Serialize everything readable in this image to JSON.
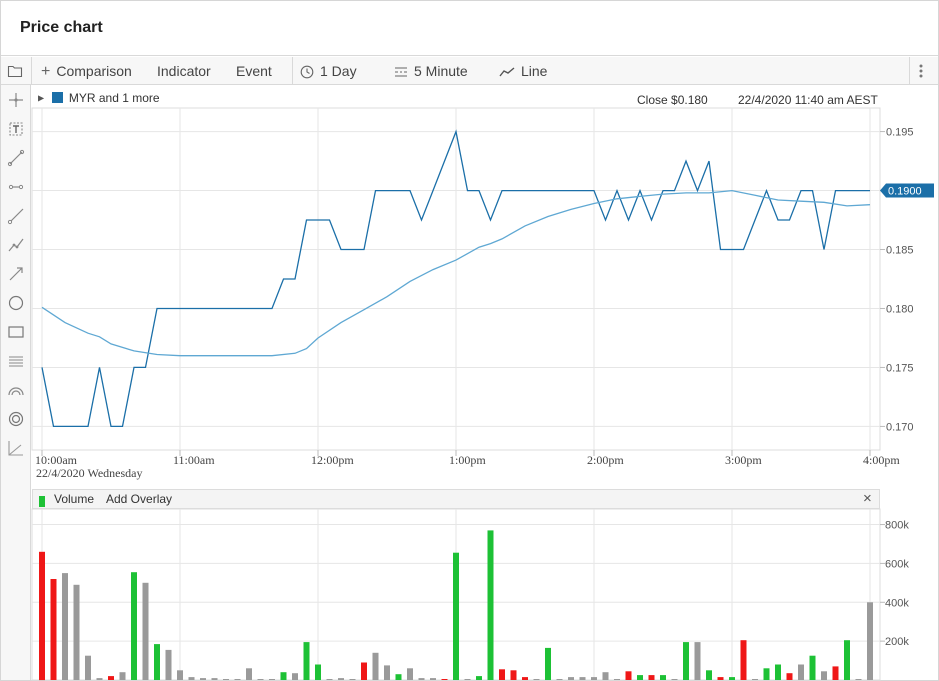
{
  "window": {
    "title": "Price chart"
  },
  "toolbar": {
    "comparison_label": "Comparison",
    "indicator_label": "Indicator",
    "event_label": "Event",
    "range_label": "1 Day",
    "interval_label": "5 Minute",
    "chart_type_label": "Line"
  },
  "legend": {
    "series_label": "MYR and 1 more",
    "close_label": "Close $0.180",
    "timestamp": "22/4/2020 11:40 am AEST",
    "series_color": "#1b6fa8"
  },
  "volume_panel": {
    "label": "Volume",
    "add_overlay_label": "Add Overlay",
    "close_symbol": "×"
  },
  "chart_data": [
    {
      "type": "line",
      "title": "",
      "x_tick_labels": [
        "10:00am",
        "11:00am",
        "12:00pm",
        "1:00pm",
        "2:00pm",
        "3:00pm",
        "4:00pm"
      ],
      "x_date_label": "22/4/2020 Wednesday",
      "x_range": [
        "10:00",
        "16:00"
      ],
      "ylim": [
        0.168,
        0.197
      ],
      "y_ticks": [
        "0.170",
        "0.175",
        "0.180",
        "0.185",
        "0.190",
        "0.195"
      ],
      "current_value_label": "0.1900",
      "grid": true,
      "series": [
        {
          "color": "#1b6fa8",
          "x": [
            "10:00",
            "10:05",
            "10:10",
            "10:15",
            "10:20",
            "10:25",
            "10:30",
            "10:35",
            "10:40",
            "10:45",
            "10:50",
            "10:55",
            "11:00",
            "11:05",
            "11:10",
            "11:15",
            "11:20",
            "11:25",
            "11:30",
            "11:35",
            "11:40",
            "11:45",
            "11:50",
            "11:55",
            "12:00",
            "12:05",
            "12:10",
            "12:15",
            "12:20",
            "12:25",
            "12:30",
            "12:35",
            "12:40",
            "12:45",
            "12:50",
            "12:55",
            "13:00",
            "13:05",
            "13:10",
            "13:15",
            "13:20",
            "13:25",
            "13:30",
            "13:35",
            "13:40",
            "13:45",
            "13:50",
            "13:55",
            "14:00",
            "14:05",
            "14:10",
            "14:15",
            "14:20",
            "14:25",
            "14:30",
            "14:35",
            "14:40",
            "14:45",
            "14:50",
            "14:55",
            "15:00",
            "15:05",
            "15:10",
            "15:15",
            "15:20",
            "15:25",
            "15:30",
            "15:35",
            "15:40",
            "15:45",
            "15:50",
            "15:55",
            "16:00"
          ],
          "values": [
            0.175,
            0.17,
            0.17,
            0.17,
            0.17,
            0.175,
            0.17,
            0.17,
            0.175,
            0.175,
            0.18,
            0.18,
            0.18,
            0.18,
            0.18,
            0.18,
            0.18,
            0.18,
            0.18,
            0.18,
            0.18,
            0.1825,
            0.1825,
            0.1875,
            0.1875,
            0.1875,
            0.185,
            0.185,
            0.185,
            0.19,
            0.19,
            0.19,
            0.19,
            0.1875,
            0.19,
            0.1925,
            0.195,
            0.19,
            0.19,
            0.1875,
            0.19,
            0.19,
            0.19,
            0.19,
            0.19,
            0.19,
            0.19,
            0.19,
            0.19,
            0.1875,
            0.19,
            0.1875,
            0.19,
            0.1875,
            0.19,
            0.19,
            0.1925,
            0.19,
            0.1925,
            0.185,
            0.185,
            0.185,
            0.1875,
            0.19,
            0.1875,
            0.1875,
            0.19,
            0.19,
            0.185,
            0.19,
            0.19,
            0.19,
            0.19
          ]
        },
        {
          "color": "#5fa8d3",
          "x": [
            "10:00",
            "10:10",
            "10:20",
            "10:25",
            "10:30",
            "10:40",
            "10:50",
            "11:00",
            "11:20",
            "11:40",
            "11:50",
            "11:55",
            "12:00",
            "12:10",
            "12:20",
            "12:30",
            "12:40",
            "12:50",
            "13:00",
            "13:10",
            "13:15",
            "13:20",
            "13:30",
            "13:40",
            "13:50",
            "14:00",
            "14:10",
            "14:20",
            "14:30",
            "14:40",
            "14:50",
            "15:00",
            "15:10",
            "15:20",
            "15:30",
            "15:40",
            "15:50",
            "16:00"
          ],
          "values": [
            0.1801,
            0.1788,
            0.1779,
            0.1776,
            0.177,
            0.1764,
            0.1761,
            0.176,
            0.176,
            0.176,
            0.1762,
            0.1766,
            0.1775,
            0.1788,
            0.1799,
            0.181,
            0.1823,
            0.1833,
            0.1841,
            0.1852,
            0.1855,
            0.1859,
            0.187,
            0.1878,
            0.1884,
            0.1889,
            0.1893,
            0.1895,
            0.1897,
            0.1898,
            0.1898,
            0.19,
            0.1896,
            0.1892,
            0.1891,
            0.189,
            0.1887,
            0.1888
          ]
        }
      ]
    },
    {
      "type": "bar",
      "title": "",
      "ylim": [
        0,
        880000
      ],
      "y_ticks": [
        "200k",
        "400k",
        "600k",
        "800k"
      ],
      "x_range": [
        "10:00",
        "16:00"
      ],
      "grid": true,
      "colors": {
        "up": "#1dc135",
        "down": "#ef1717",
        "flat": "#9a9a9a"
      },
      "bars": [
        {
          "t": "10:00",
          "v": 660000,
          "c": "down"
        },
        {
          "t": "10:05",
          "v": 520000,
          "c": "down"
        },
        {
          "t": "10:10",
          "v": 550000,
          "c": "flat"
        },
        {
          "t": "10:15",
          "v": 490000,
          "c": "flat"
        },
        {
          "t": "10:20",
          "v": 125000,
          "c": "flat"
        },
        {
          "t": "10:25",
          "v": 10000,
          "c": "flat"
        },
        {
          "t": "10:30",
          "v": 20000,
          "c": "down"
        },
        {
          "t": "10:35",
          "v": 40000,
          "c": "flat"
        },
        {
          "t": "10:40",
          "v": 555000,
          "c": "up"
        },
        {
          "t": "10:45",
          "v": 500000,
          "c": "flat"
        },
        {
          "t": "10:50",
          "v": 185000,
          "c": "up"
        },
        {
          "t": "10:55",
          "v": 155000,
          "c": "flat"
        },
        {
          "t": "11:00",
          "v": 50000,
          "c": "flat"
        },
        {
          "t": "11:05",
          "v": 15000,
          "c": "flat"
        },
        {
          "t": "11:10",
          "v": 10000,
          "c": "flat"
        },
        {
          "t": "11:15",
          "v": 10000,
          "c": "flat"
        },
        {
          "t": "11:20",
          "v": 5000,
          "c": "flat"
        },
        {
          "t": "11:25",
          "v": 5000,
          "c": "flat"
        },
        {
          "t": "11:30",
          "v": 60000,
          "c": "flat"
        },
        {
          "t": "11:35",
          "v": 5000,
          "c": "flat"
        },
        {
          "t": "11:40",
          "v": 5000,
          "c": "flat"
        },
        {
          "t": "11:45",
          "v": 40000,
          "c": "up"
        },
        {
          "t": "11:50",
          "v": 35000,
          "c": "flat"
        },
        {
          "t": "11:55",
          "v": 195000,
          "c": "up"
        },
        {
          "t": "12:00",
          "v": 80000,
          "c": "up"
        },
        {
          "t": "12:05",
          "v": 5000,
          "c": "flat"
        },
        {
          "t": "12:10",
          "v": 10000,
          "c": "flat"
        },
        {
          "t": "12:15",
          "v": 5000,
          "c": "flat"
        },
        {
          "t": "12:20",
          "v": 90000,
          "c": "down"
        },
        {
          "t": "12:25",
          "v": 140000,
          "c": "flat"
        },
        {
          "t": "12:30",
          "v": 75000,
          "c": "flat"
        },
        {
          "t": "12:35",
          "v": 30000,
          "c": "up"
        },
        {
          "t": "12:40",
          "v": 60000,
          "c": "flat"
        },
        {
          "t": "12:45",
          "v": 10000,
          "c": "flat"
        },
        {
          "t": "12:50",
          "v": 10000,
          "c": "flat"
        },
        {
          "t": "12:55",
          "v": 5000,
          "c": "down"
        },
        {
          "t": "13:00",
          "v": 655000,
          "c": "up"
        },
        {
          "t": "13:05",
          "v": 5000,
          "c": "flat"
        },
        {
          "t": "13:10",
          "v": 20000,
          "c": "up"
        },
        {
          "t": "13:15",
          "v": 770000,
          "c": "up"
        },
        {
          "t": "13:20",
          "v": 55000,
          "c": "down"
        },
        {
          "t": "13:25",
          "v": 50000,
          "c": "down"
        },
        {
          "t": "13:30",
          "v": 15000,
          "c": "down"
        },
        {
          "t": "13:35",
          "v": 5000,
          "c": "flat"
        },
        {
          "t": "13:40",
          "v": 165000,
          "c": "up"
        },
        {
          "t": "13:45",
          "v": 5000,
          "c": "flat"
        },
        {
          "t": "13:50",
          "v": 15000,
          "c": "flat"
        },
        {
          "t": "13:55",
          "v": 15000,
          "c": "flat"
        },
        {
          "t": "14:00",
          "v": 15000,
          "c": "flat"
        },
        {
          "t": "14:05",
          "v": 40000,
          "c": "flat"
        },
        {
          "t": "14:10",
          "v": 5000,
          "c": "flat"
        },
        {
          "t": "14:15",
          "v": 45000,
          "c": "down"
        },
        {
          "t": "14:20",
          "v": 25000,
          "c": "up"
        },
        {
          "t": "14:25",
          "v": 25000,
          "c": "down"
        },
        {
          "t": "14:30",
          "v": 25000,
          "c": "up"
        },
        {
          "t": "14:35",
          "v": 5000,
          "c": "flat"
        },
        {
          "t": "14:40",
          "v": 195000,
          "c": "up"
        },
        {
          "t": "14:45",
          "v": 195000,
          "c": "flat"
        },
        {
          "t": "14:50",
          "v": 50000,
          "c": "up"
        },
        {
          "t": "14:55",
          "v": 15000,
          "c": "down"
        },
        {
          "t": "15:00",
          "v": 15000,
          "c": "up"
        },
        {
          "t": "15:05",
          "v": 205000,
          "c": "down"
        },
        {
          "t": "15:10",
          "v": 5000,
          "c": "flat"
        },
        {
          "t": "15:15",
          "v": 60000,
          "c": "up"
        },
        {
          "t": "15:20",
          "v": 80000,
          "c": "up"
        },
        {
          "t": "15:25",
          "v": 35000,
          "c": "down"
        },
        {
          "t": "15:30",
          "v": 80000,
          "c": "flat"
        },
        {
          "t": "15:35",
          "v": 125000,
          "c": "up"
        },
        {
          "t": "15:40",
          "v": 45000,
          "c": "flat"
        },
        {
          "t": "15:45",
          "v": 70000,
          "c": "down"
        },
        {
          "t": "15:50",
          "v": 205000,
          "c": "up"
        },
        {
          "t": "15:55",
          "v": 5000,
          "c": "flat"
        },
        {
          "t": "16:00",
          "v": 400000,
          "c": "flat"
        }
      ]
    }
  ],
  "icons": {
    "left_tools": [
      "crosshair-icon",
      "text-annotation-icon",
      "line-tool-icon",
      "horizontal-line-icon",
      "ray-tool-icon",
      "polyline-tool-icon",
      "arrow-tool-icon",
      "circle-tool-icon",
      "rectangle-tool-icon",
      "parallel-lines-icon",
      "arc-tool-icon",
      "target-tool-icon",
      "fibonacci-tool-icon"
    ]
  }
}
